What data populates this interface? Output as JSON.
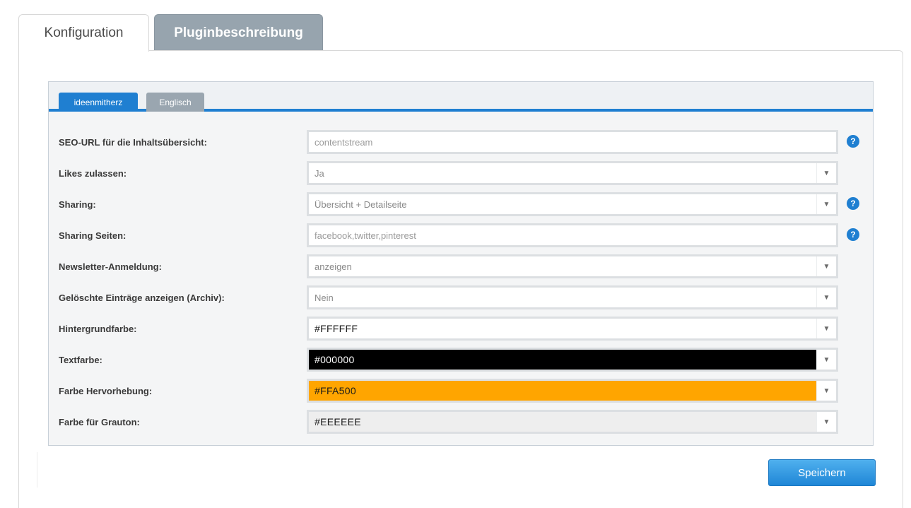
{
  "top_tabs": {
    "config": "Konfiguration",
    "description": "Pluginbeschreibung"
  },
  "lang_tabs": {
    "active": "ideenmitherz",
    "inactive": "Englisch"
  },
  "rows": [
    {
      "label": "SEO-URL für die Inhaltsübersicht:",
      "value": "contentstream"
    },
    {
      "label": "Likes zulassen:",
      "value": "Ja"
    },
    {
      "label": "Sharing:",
      "value": "Übersicht + Detailseite"
    },
    {
      "label": "Sharing Seiten:",
      "value": "facebook,twitter,pinterest"
    },
    {
      "label": "Newsletter-Anmeldung:",
      "value": "anzeigen"
    },
    {
      "label": "Gelöschte Einträge anzeigen (Archiv):",
      "value": "Nein"
    },
    {
      "label": "Hintergrundfarbe:",
      "value": "#FFFFFF"
    },
    {
      "label": "Textfarbe:",
      "value": "#000000"
    },
    {
      "label": "Farbe Hervorhebung:",
      "value": "#FFA500"
    },
    {
      "label": "Farbe für Grauton:",
      "value": "#EEEEEE"
    }
  ],
  "help_icon_glyph": "?",
  "dropdown_glyph": "▼",
  "colors": {
    "accent": "#1f7fd1",
    "highlight": "#FFA500",
    "text_color_swatch": "#000000",
    "grey_swatch": "#EEEEEE"
  },
  "save_label": "Speichern"
}
